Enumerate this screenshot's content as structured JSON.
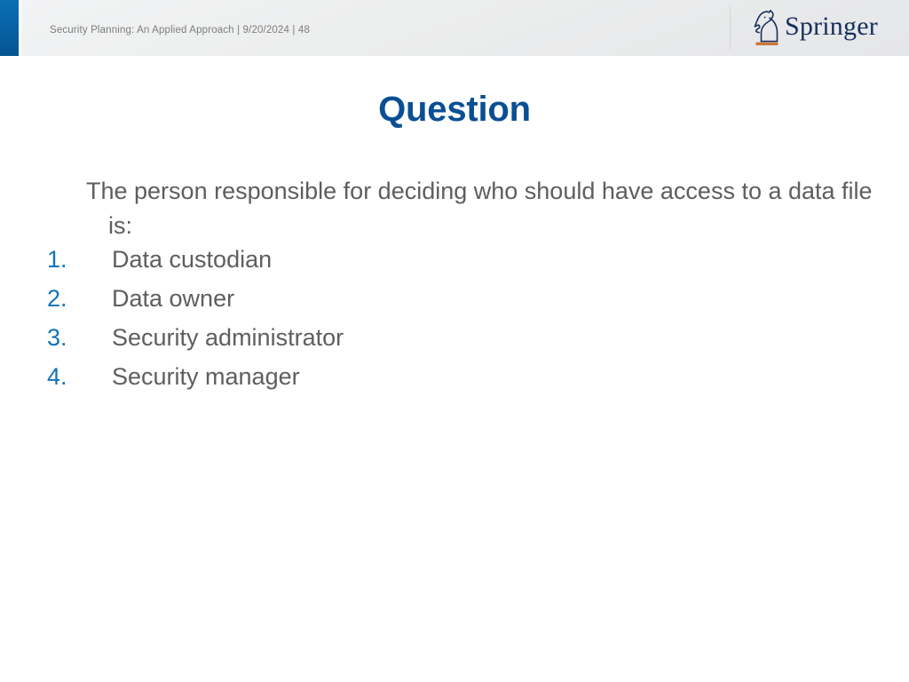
{
  "header": {
    "breadcrumb": "Security Planning: An Applied Approach | 9/20/2024 | 48",
    "accent_color": "#0a66ab",
    "band_color": "#eceded",
    "logo": {
      "mark_icon": "springer-knight-icon",
      "wordmark": "Springer",
      "wordmark_color": "#16305c",
      "mark_base_color": "#c8793a"
    }
  },
  "slide": {
    "title": "Question",
    "title_color": "#0b4f93",
    "lead_paragraph": "The person responsible for deciding who should have access to a data file is:",
    "body_color": "#5e5e5e",
    "number_color": "#1273b8",
    "answers": [
      {
        "number": "1.",
        "label": "Data custodian"
      },
      {
        "number": "2.",
        "label": "Data owner"
      },
      {
        "number": "3.",
        "label": "Security administrator"
      },
      {
        "number": "4.",
        "label": "Security manager"
      }
    ]
  }
}
